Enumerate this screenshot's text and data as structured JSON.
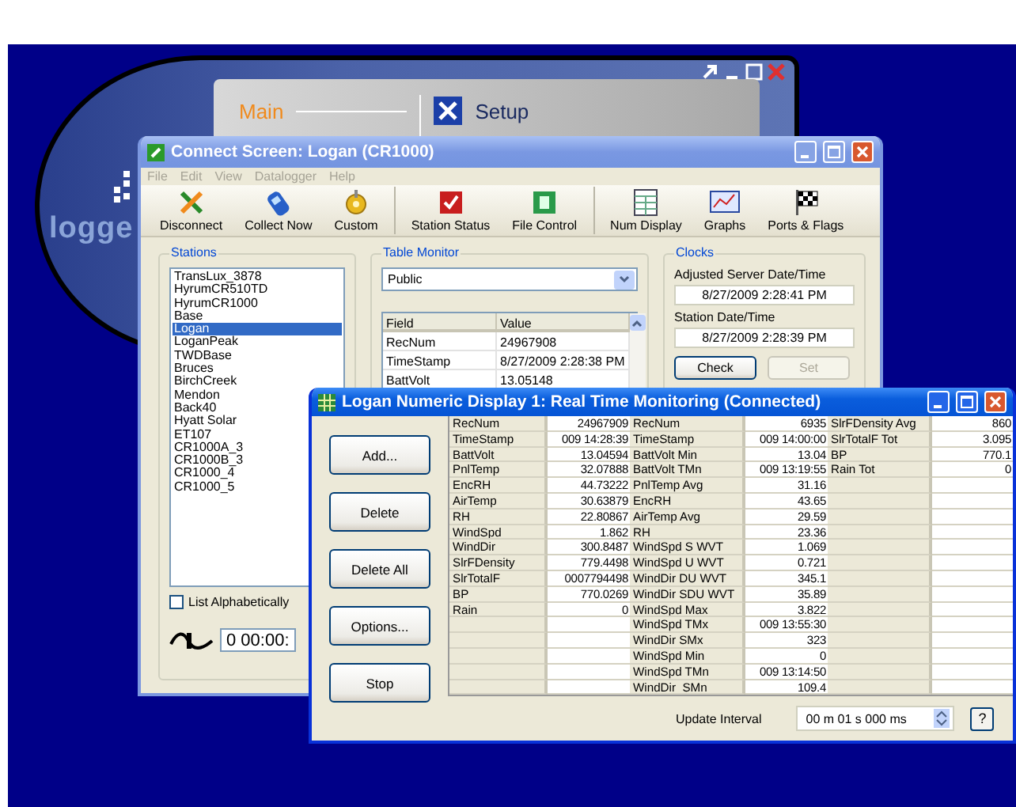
{
  "background_app": {
    "logo_text": "logge",
    "nav": [
      {
        "label": "Main",
        "selected": true
      },
      {
        "label": "Setup",
        "selected": false
      }
    ]
  },
  "connect_window": {
    "title": "Connect Screen: Logan (CR1000)",
    "menu": [
      "File",
      "Edit",
      "View",
      "Datalogger",
      "Help"
    ],
    "toolbar_groups": [
      [
        {
          "label": "Disconnect",
          "kind": "disconnect"
        },
        {
          "label": "Collect Now",
          "kind": "collect"
        },
        {
          "label": "Custom",
          "kind": "custom"
        }
      ],
      [
        {
          "label": "Station Status",
          "kind": "status"
        },
        {
          "label": "File Control",
          "kind": "file"
        }
      ],
      [
        {
          "label": "Num Display",
          "kind": "numeric"
        },
        {
          "label": "Graphs",
          "kind": "graph"
        },
        {
          "label": "Ports & Flags",
          "kind": "flags"
        }
      ]
    ],
    "stations": {
      "title": "Stations",
      "items": [
        {
          "name": "TransLux_3878",
          "selected": false
        },
        {
          "name": "HyrumCR510TD",
          "selected": false
        },
        {
          "name": "HyrumCR1000",
          "selected": false
        },
        {
          "name": "Base",
          "selected": false
        },
        {
          "name": "Logan",
          "selected": true
        },
        {
          "name": "LoganPeak",
          "selected": false
        },
        {
          "name": "TWDBase",
          "selected": false
        },
        {
          "name": "Bruces",
          "selected": false
        },
        {
          "name": "BirchCreek",
          "selected": false
        },
        {
          "name": "Mendon",
          "selected": false
        },
        {
          "name": "Back40",
          "selected": false
        },
        {
          "name": "Hyatt Solar",
          "selected": false
        },
        {
          "name": "ET107",
          "selected": false
        },
        {
          "name": "CR1000A_3",
          "selected": false
        },
        {
          "name": "CR1000B_3",
          "selected": false
        },
        {
          "name": "CR1000_4",
          "selected": false
        },
        {
          "name": "CR1000_5",
          "selected": false
        }
      ],
      "list_alphabetically": {
        "label": "List Alphabetically",
        "checked": false
      },
      "timer": "0 00:00:"
    },
    "table_monitor": {
      "title": "Table Monitor",
      "table": "Public",
      "columns": [
        "Field",
        "Value"
      ],
      "rows": [
        {
          "field": "RecNum",
          "value": "24967908"
        },
        {
          "field": "TimeStamp",
          "value": "8/27/2009 2:28:38 PM"
        },
        {
          "field": "BattVolt",
          "value": "13.05148"
        }
      ]
    },
    "clocks": {
      "title": "Clocks",
      "server_label": "Adjusted Server Date/Time",
      "server_time": "8/27/2009 2:28:41 PM",
      "station_label": "Station Date/Time",
      "station_time": "8/27/2009 2:28:39 PM",
      "buttons": [
        {
          "label": "Check",
          "disabled": false
        },
        {
          "label": "Set",
          "disabled": true
        }
      ]
    }
  },
  "numeric_window": {
    "title": "Logan Numeric Display 1: Real Time Monitoring (Connected)",
    "buttons": [
      "Add...",
      "Delete",
      "Delete All",
      "Options...",
      "Stop"
    ],
    "groups": [
      [
        {
          "name": "RecNum",
          "value": "24967909"
        },
        {
          "name": "TimeStamp",
          "value": "009 14:28:39"
        },
        {
          "name": "BattVolt",
          "value": "13.04594"
        },
        {
          "name": "PnlTemp",
          "value": "32.07888"
        },
        {
          "name": "EncRH",
          "value": "44.73222"
        },
        {
          "name": "AirTemp",
          "value": "30.63879"
        },
        {
          "name": "RH",
          "value": "22.80867"
        },
        {
          "name": "WindSpd",
          "value": "1.862"
        },
        {
          "name": "WindDir",
          "value": "300.8487"
        },
        {
          "name": "SlrFDensity",
          "value": "779.4498"
        },
        {
          "name": "SlrTotalF",
          "value": "0007794498"
        },
        {
          "name": "BP",
          "value": "770.0269"
        },
        {
          "name": "Rain",
          "value": "0"
        }
      ],
      [
        {
          "name": "RecNum",
          "value": "6935"
        },
        {
          "name": "TimeStamp",
          "value": "009 14:00:00"
        },
        {
          "name": "BattVolt Min",
          "value": "13.04"
        },
        {
          "name": "BattVolt TMn",
          "value": "009 13:19:55"
        },
        {
          "name": "PnlTemp Avg",
          "value": "31.16"
        },
        {
          "name": "EncRH",
          "value": "43.65"
        },
        {
          "name": "AirTemp Avg",
          "value": "29.59"
        },
        {
          "name": "RH",
          "value": "23.36"
        },
        {
          "name": "WindSpd S WVT",
          "value": "1.069"
        },
        {
          "name": "WindSpd U WVT",
          "value": "0.721"
        },
        {
          "name": "WindDir DU WVT",
          "value": "345.1"
        },
        {
          "name": "WindDir SDU WVT",
          "value": "35.89"
        },
        {
          "name": "WindSpd Max",
          "value": "3.822"
        },
        {
          "name": "WindSpd TMx",
          "value": "009 13:55:30"
        },
        {
          "name": "WindDir SMx",
          "value": "323"
        },
        {
          "name": "WindSpd Min",
          "value": "0"
        },
        {
          "name": "WindSpd TMn",
          "value": "009 13:14:50"
        },
        {
          "name": "WindDir_SMn",
          "value": "109.4"
        }
      ],
      [
        {
          "name": "SlrFDensity Avg",
          "value": "860"
        },
        {
          "name": "SlrTotalF Tot",
          "value": "3.095"
        },
        {
          "name": "BP",
          "value": "770.1"
        },
        {
          "name": "Rain Tot",
          "value": "0"
        }
      ]
    ],
    "update_interval": {
      "label": "Update Interval",
      "value": "00 m 01 s 000 ms"
    },
    "help": "?"
  }
}
